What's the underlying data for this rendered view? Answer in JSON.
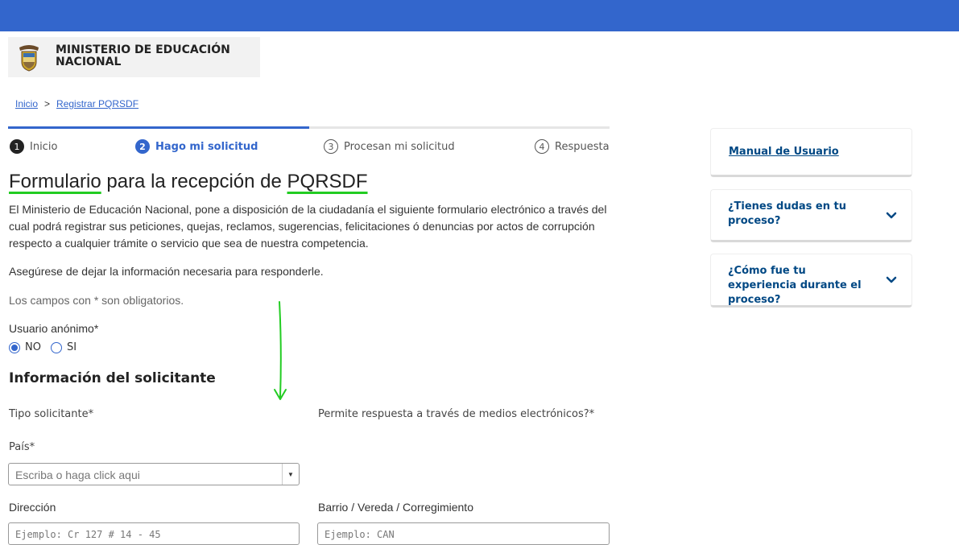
{
  "header": {
    "bar_color": "#3366cc"
  },
  "logo": {
    "name": "MINISTERIO DE EDUCACIÓN NACIONAL",
    "icon": "coat-of-arms-icon"
  },
  "breadcrumb": {
    "home": "Inicio",
    "separator": ">",
    "current": "Registrar PQRSDF"
  },
  "steps": [
    {
      "number": "1",
      "label": "Inicio"
    },
    {
      "number": "2",
      "label": "Hago mi solicitud"
    },
    {
      "number": "3",
      "label": "Procesan mi solicitud"
    },
    {
      "number": "4",
      "label": "Respuesta"
    }
  ],
  "progress": {
    "active_step": 2,
    "fraction": 0.5
  },
  "form": {
    "title_part1": "Formulario",
    "title_part2": " para la recepción de ",
    "title_part3": "PQRSDF",
    "intro": "El Ministerio de Educación Nacional, pone a disposición de la ciudadanía el siguiente formulario electrónico a través del cual podrá registrar sus peticiones, quejas, reclamos, sugerencias, felicitaciones ó denuncias por actos de corrupción respecto a cualquier trámite o servicio que sea de nuestra competencia.",
    "reminder": "Asegúrese de dejar la información necesaria para responderle.",
    "required_note": "Los campos con * son obligatorios.",
    "anon_label": "Usuario anónimo*",
    "anon_options": [
      "NO",
      "SI"
    ],
    "anon_selected": "NO",
    "section_title": "Información del solicitante",
    "tipo_label": "Tipo solicitante*",
    "electronic_label": "Permite respuesta a través de medios electrónicos?*",
    "pais_label": "País*",
    "pais_placeholder": "Escriba o haga click aqui",
    "direccion_label": "Dirección",
    "direccion_placeholder": "Ejemplo: Cr 127 # 14 - 45",
    "barrio_label": "Barrio / Vereda / Corregimiento",
    "barrio_placeholder": "Ejemplo: CAN"
  },
  "sidebar": {
    "manual_link": "Manual de Usuario",
    "faq1": "¿Tienes dudas en tu proceso?",
    "faq2": "¿Cómo fue tu experiencia durante el proceso?"
  },
  "colors": {
    "accent": "#3366cc",
    "annotation": "#22cc22",
    "link_dark": "#004884"
  }
}
